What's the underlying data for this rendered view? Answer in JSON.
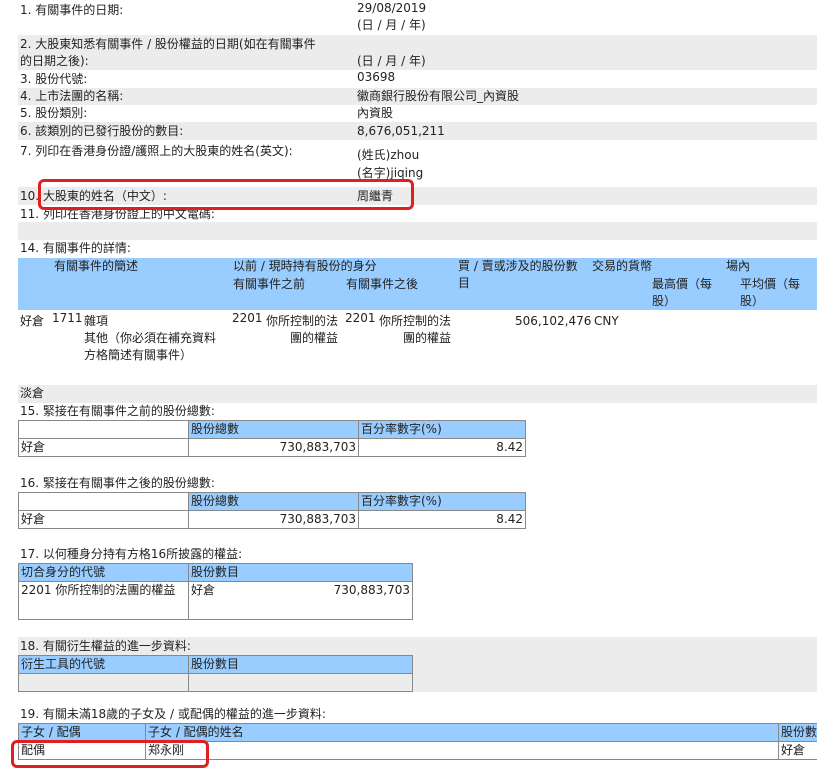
{
  "fields": [
    {
      "label": "1. 有關事件的日期:",
      "value": "29/08/2019",
      "sub": "(日 / 月 / 年)"
    },
    {
      "label": "2. 大股東知悉有關事件 / 股份權益的日期(如在有關事件",
      "label2": "的日期之後):",
      "value": "(日 / 月 / 年)"
    },
    {
      "label": "3. 股份代號:",
      "value": "03698"
    },
    {
      "label": "4. 上市法團的名稱:",
      "value": "徽商銀行股份有限公司_內資股"
    },
    {
      "label": "5. 股份類別:",
      "value": "內資股"
    },
    {
      "label": "6. 該類別的已發行股份的數目:",
      "value": "8,676,051,211"
    },
    {
      "label": "7. 列印在香港身份證/護照上的大股東的姓名(英文):",
      "value": "(姓氏)zhou",
      "sub": "(名字)jiqing"
    },
    {
      "label": "10. 大股東的姓名（中文）:",
      "value": "周繼青"
    },
    {
      "label": "11. 列印在香港身份證上的中文電碼:"
    }
  ],
  "s14": {
    "title": "14. 有關事件的詳情:",
    "headers": {
      "desc": "有關事件的簡述",
      "capacity": "以前 / 現時持有股份的身分",
      "before": "有關事件之前",
      "after": "有關事件之後",
      "shares": "買 / 賣或涉及的股份數目",
      "currency": "交易的貨幣",
      "onexch": "場內",
      "high": "最高價（每股）",
      "avg": "平均價（每股）"
    },
    "row": {
      "position": "好倉",
      "code": "1711",
      "desc1": "雜項",
      "desc2": "其他（你必須在補充資料方格簡述有關事件）",
      "before_code": "2201",
      "before": "你所控制的法團的權益",
      "after_code": "2201",
      "after": "你所控制的法團的權益",
      "shares": "506,102,476",
      "currency": "CNY"
    },
    "short": "淡倉"
  },
  "s15": {
    "title": "15. 緊接在有關事件之前的股份總數:",
    "h1": "股份總數",
    "h2": "百分率數字(%)",
    "pos": "好倉",
    "total": "730,883,703",
    "pct": "8.42"
  },
  "s16": {
    "title": "16. 緊接在有關事件之後的股份總數:",
    "h1": "股份總數",
    "h2": "百分率數字(%)",
    "pos": "好倉",
    "total": "730,883,703",
    "pct": "8.42"
  },
  "s17": {
    "title": "17. 以何種身分持有方格16所披露的權益:",
    "h1": "切合身分的代號",
    "h2": "股份數目",
    "code": "2201",
    "cap": "你所控制的法團的權益",
    "pos": "好倉",
    "num": "730,883,703"
  },
  "s18": {
    "title": "18. 有關衍生權益的進一步資料:",
    "h1": "衍生工具的代號",
    "h2": "股份數目"
  },
  "s19": {
    "title": "19. 有關未滿18歲的子女及 / 或配偶的權益的進一步資料:",
    "h1": "子女 / 配偶",
    "h2": "子女 / 配偶的姓名",
    "h3": "股份數",
    "rel": "配偶",
    "name": "郑永刚",
    "pos": "好倉"
  }
}
